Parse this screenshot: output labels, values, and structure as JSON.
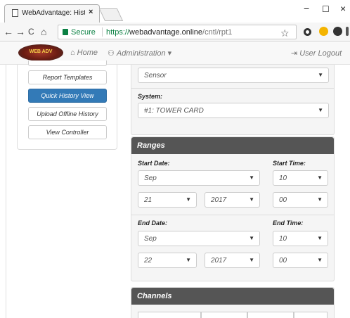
{
  "browser": {
    "tab_title": "WebAdvantage: History",
    "tab_close": "×",
    "win_min": "−",
    "win_max": "☐",
    "win_close": "×",
    "nav_back": "←",
    "nav_forward": "→",
    "nav_reload": "C",
    "nav_home": "⌂",
    "secure_label": "Secure",
    "url_scheme": "https://",
    "url_host": "webadvantage.online",
    "url_path": "/cntl/rpt1",
    "star": "☆"
  },
  "navbar": {
    "logo_text": "WEB ADV",
    "home_icon": "⌂",
    "home_label": "Home",
    "admin_icon": "⚇",
    "admin_label": "Administration ▾",
    "logout_icon": "⇥",
    "logout_label": "User Logout"
  },
  "sidebar": {
    "items": [
      {
        "label": "Report Templates"
      },
      {
        "label": "Quick History View"
      },
      {
        "label": "Upload Offline History"
      },
      {
        "label": "View Controller"
      }
    ]
  },
  "top_panel": {
    "sensor_value": "Sensor",
    "system_label": "System:",
    "system_value": "#1: TOWER CARD"
  },
  "ranges": {
    "title": "Ranges",
    "start_date_label": "Start Date:",
    "start_time_label": "Start Time:",
    "start_month": "Sep",
    "start_day": "21",
    "start_year": "2017",
    "start_hour": "10",
    "start_minute": "00",
    "end_date_label": "End Date:",
    "end_time_label": "End Time:",
    "end_month": "Sep",
    "end_day": "22",
    "end_year": "2017",
    "end_hour": "10",
    "end_minute": "00"
  },
  "channels": {
    "title": "Channels"
  },
  "colors": {
    "accent": "#337ab7",
    "panel_header": "#555555",
    "secure_green": "#0b8043"
  }
}
